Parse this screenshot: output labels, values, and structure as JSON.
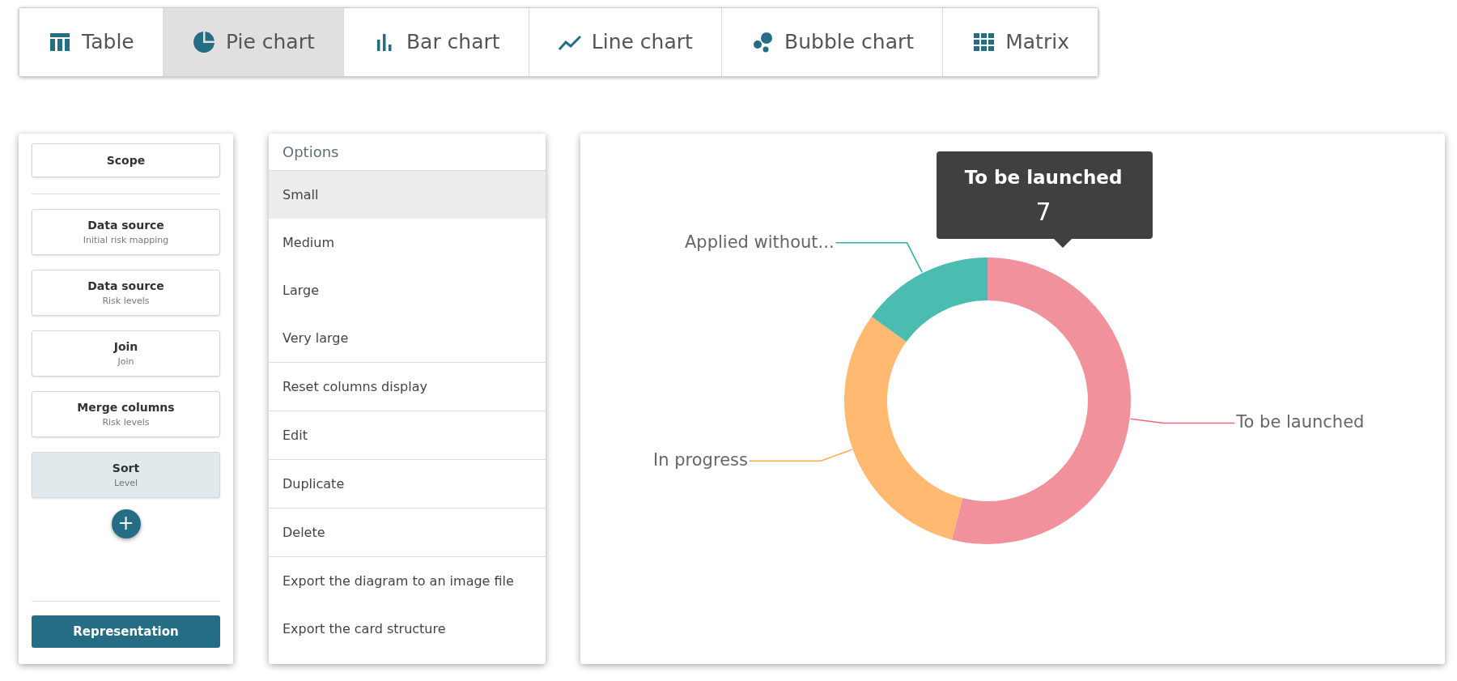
{
  "tabs": [
    {
      "label": "Table",
      "selected": false
    },
    {
      "label": "Pie chart",
      "selected": true
    },
    {
      "label": "Bar chart",
      "selected": false
    },
    {
      "label": "Line chart",
      "selected": false
    },
    {
      "label": "Bubble chart",
      "selected": false
    },
    {
      "label": "Matrix",
      "selected": false
    }
  ],
  "pipeline": {
    "scope": "Scope",
    "steps": [
      {
        "title": "Data source",
        "subtitle": "Initial risk mapping",
        "selected": false
      },
      {
        "title": "Data source",
        "subtitle": "Risk levels",
        "selected": false
      },
      {
        "title": "Join",
        "subtitle": "Join",
        "selected": false
      },
      {
        "title": "Merge columns",
        "subtitle": "Risk levels",
        "selected": false
      },
      {
        "title": "Sort",
        "subtitle": "Level",
        "selected": true
      }
    ],
    "add_button": "+",
    "representation_button": "Representation"
  },
  "options": {
    "title": "Options",
    "groups": [
      [
        {
          "label": "Small",
          "selected": true
        },
        {
          "label": "Medium",
          "selected": false
        },
        {
          "label": "Large",
          "selected": false
        },
        {
          "label": "Very large",
          "selected": false
        }
      ],
      [
        {
          "label": "Reset columns display",
          "selected": false
        }
      ],
      [
        {
          "label": "Edit",
          "selected": false
        }
      ],
      [
        {
          "label": "Duplicate",
          "selected": false
        }
      ],
      [
        {
          "label": "Delete",
          "selected": false
        }
      ],
      [
        {
          "label": "Export the diagram to an image file",
          "selected": false
        },
        {
          "label": "Export the card structure",
          "selected": false
        }
      ]
    ]
  },
  "chart": {
    "chart_data": {
      "type": "donut",
      "categories": [
        "To be launched",
        "In progress",
        "Applied without..."
      ],
      "values": [
        54,
        31,
        15
      ]
    },
    "tooltip": {
      "title": "To be launched",
      "value": "7"
    }
  }
}
